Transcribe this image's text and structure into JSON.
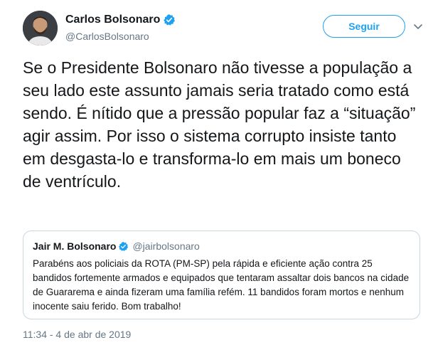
{
  "tweet": {
    "author": {
      "display_name": "Carlos Bolsonaro",
      "handle": "@CarlosBolsonaro",
      "verified": true
    },
    "follow_label": "Seguir",
    "text": "Se o Presidente Bolsonaro não tivesse a população a seu lado este assunto jamais seria tratado como está sendo. É nítido que a pressão popular faz a “situação” agir assim. Por isso o sistema corrupto insiste tanto em desgasta-lo e transforma-lo em mais um boneco de ventrículo.",
    "timestamp": "11:34 - 4 de abr de 2019"
  },
  "quoted_tweet": {
    "display_name": "Jair M. Bolsonaro",
    "handle": "@jairbolsonaro",
    "verified": true,
    "text": "Parabéns aos policiais da ROTA (PM-SP) pela rápida e eficiente ação contra 25 bandidos fortemente armados e equipados que tentaram assaltar dois bancos na cidade de Guararema e ainda fizeram uma família refém. 11 bandidos foram mortos e nenhum inocente saiu ferido. Bom trabalho!"
  },
  "icons": {
    "verified": "verified-badge-icon",
    "menu": "chevron-down-icon"
  },
  "colors": {
    "accent": "#1da1f2",
    "text": "#14171a",
    "secondary_text": "#657786",
    "border": "#ccd6dd"
  }
}
